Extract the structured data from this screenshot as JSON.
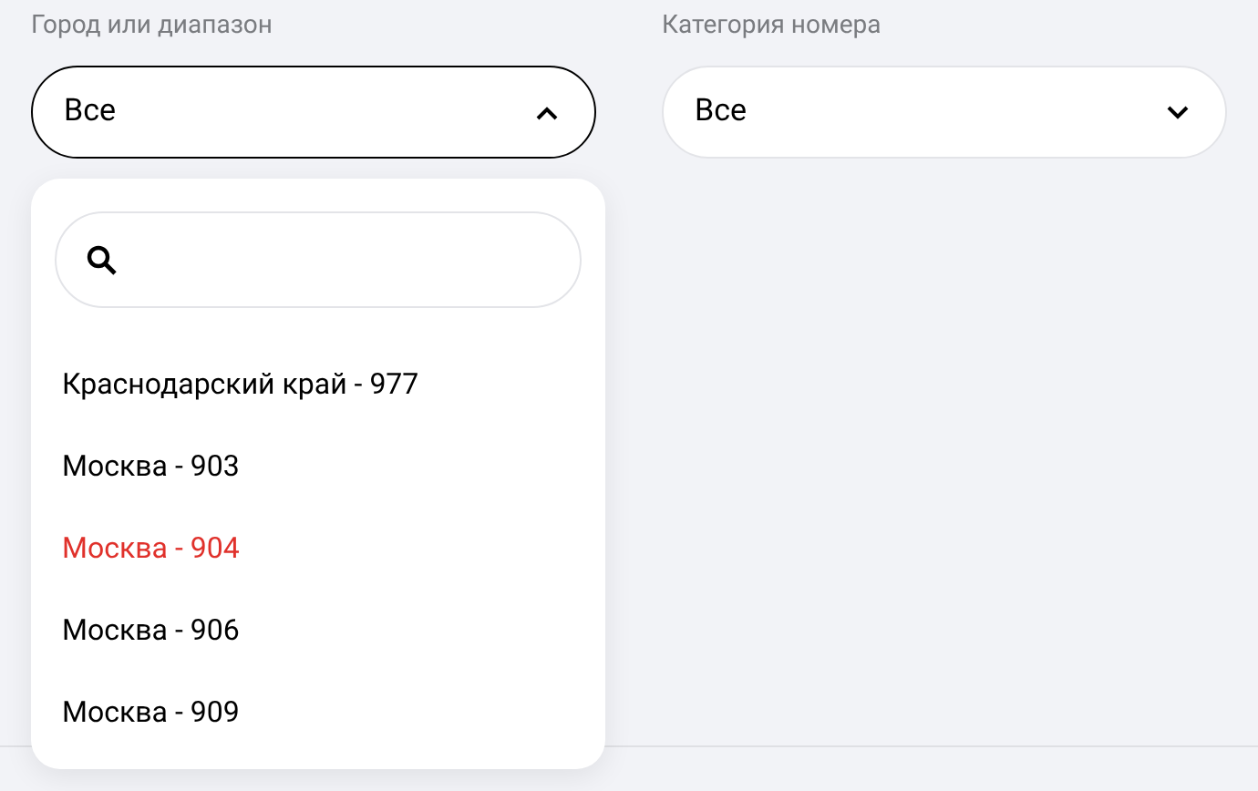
{
  "filters": [
    {
      "label": "Город или диапазон",
      "value": "Все",
      "expanded": true
    },
    {
      "label": "Категория номера",
      "value": "Все",
      "expanded": false
    }
  ],
  "dropdown": {
    "items": [
      {
        "label": "Краснодарский край - 977",
        "selected": false
      },
      {
        "label": "Москва - 903",
        "selected": false
      },
      {
        "label": "Москва - 904",
        "selected": true
      },
      {
        "label": "Москва - 906",
        "selected": false
      },
      {
        "label": "Москва - 909",
        "selected": false
      }
    ]
  }
}
